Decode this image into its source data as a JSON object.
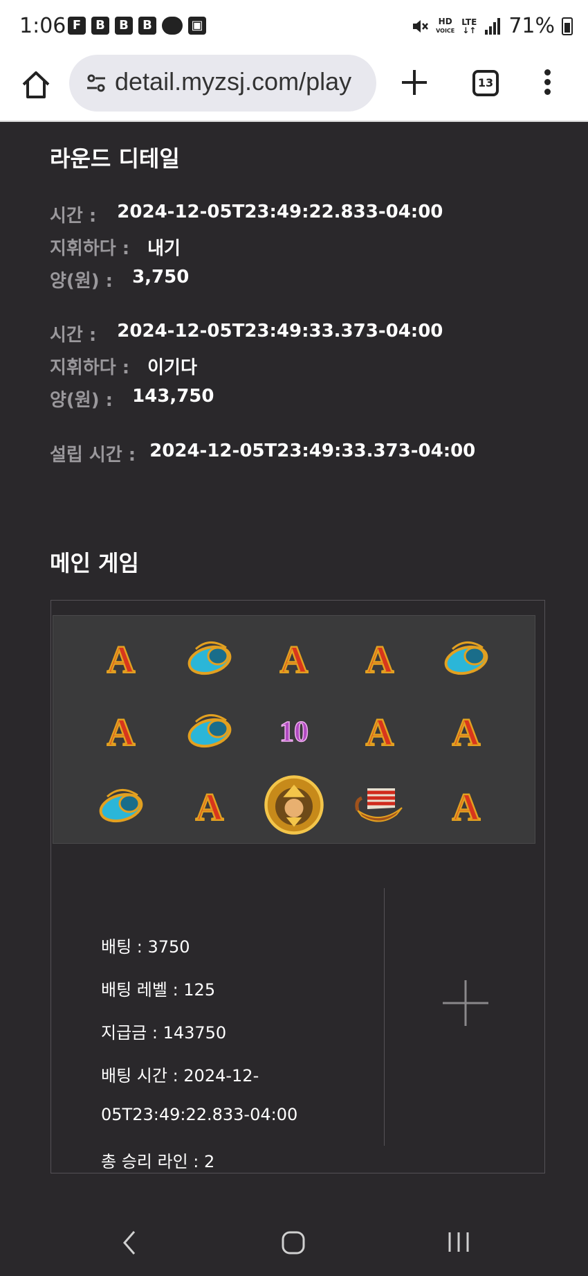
{
  "status_bar": {
    "time": "1:06",
    "battery": "71%",
    "notifications": [
      "flipboard-icon",
      "b-icon",
      "b-icon",
      "b-icon",
      "cloud-icon",
      "image-icon"
    ],
    "system_icons": [
      "mute-icon",
      "hd-voice-icon",
      "lte-icon",
      "signal-icon",
      "battery-icon"
    ]
  },
  "browser": {
    "url": "detail.myzsj.com/play",
    "tab_count": "13"
  },
  "round_detail": {
    "title": "라운드 디테일",
    "entries": [
      {
        "time_label": "시간 :",
        "time_value": "2024-12-05T23:49:22.833-04:00",
        "action_label": "지휘하다 :",
        "action_value": "내기",
        "amount_label": "양(원) :",
        "amount_value": "3,750"
      },
      {
        "time_label": "시간 :",
        "time_value": "2024-12-05T23:49:33.373-04:00",
        "action_label": "지휘하다 :",
        "action_value": "이기다",
        "amount_label": "양(원) :",
        "amount_value": "143,750"
      }
    ],
    "settle_label": "설립 시간 :",
    "settle_value": "2024-12-05T23:49:33.373-04:00"
  },
  "main_game": {
    "title": "메인 게임",
    "symbols": [
      [
        "A",
        "horn",
        "A",
        "A",
        "horn"
      ],
      [
        "A",
        "horn",
        "10",
        "A",
        "A"
      ],
      [
        "horn",
        "A",
        "viking",
        "ship",
        "A"
      ]
    ],
    "info": {
      "bet": "배팅 : 3750",
      "bet_level": "배팅 레벨 : 125",
      "payout": "지급금 : 143750",
      "bet_time_line1": "배팅 시간 : 2024-12-",
      "bet_time_line2": "05T23:49:22.833-04:00",
      "win_lines": "총 승리 라인 : 2"
    }
  },
  "colors": {
    "background": "#2a282b",
    "label_gray": "#9a989c",
    "symbol_red": "#d8361c",
    "symbol_gold": "#e2a020",
    "horn_blue": "#2bb6d8",
    "ten_purple": "#b04ac0"
  }
}
